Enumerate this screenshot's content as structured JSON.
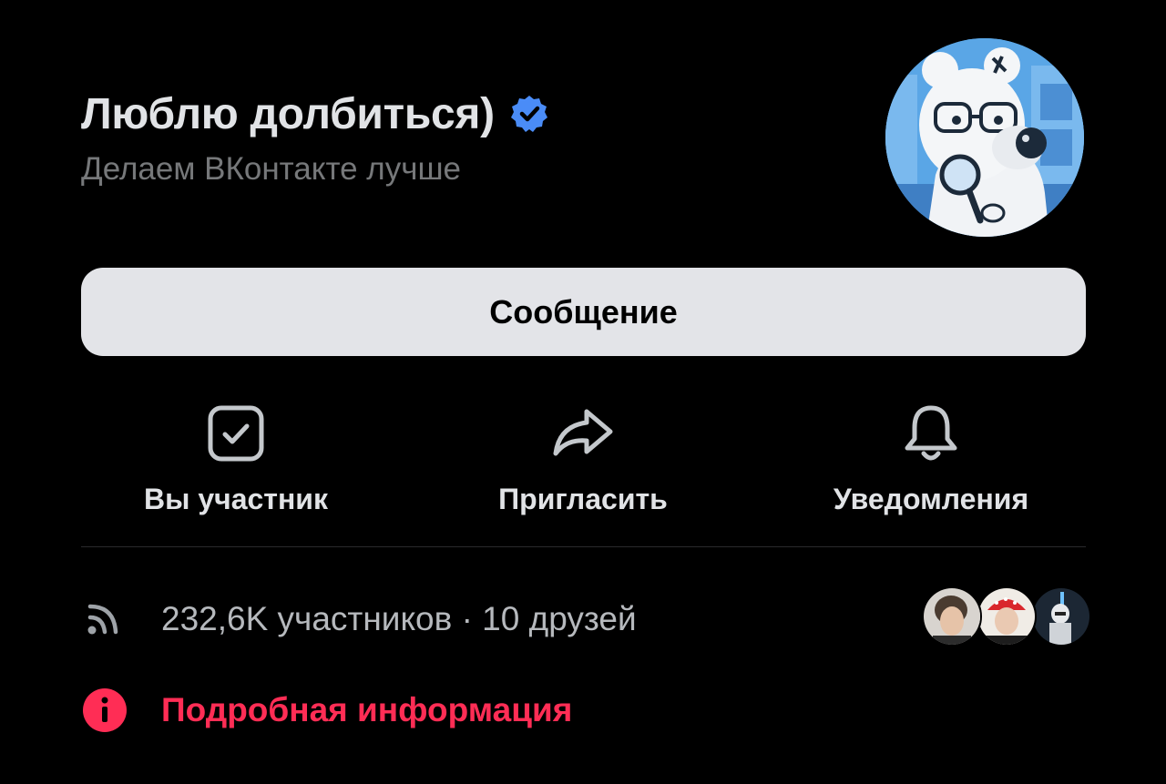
{
  "community": {
    "name": "Люблю долбиться)",
    "status": "Делаем ВКонтакте лучше"
  },
  "primary_action": {
    "label": "Сообщение"
  },
  "actions": [
    {
      "label": "Вы участник",
      "icon": "checkbox-checked-icon"
    },
    {
      "label": "Пригласить",
      "icon": "share-arrow-icon"
    },
    {
      "label": "Уведомления",
      "icon": "bell-icon"
    }
  ],
  "stats": {
    "text": "232,6K участников · 10 друзей",
    "icon": "rss-icon"
  },
  "details": {
    "label": "Подробная информация",
    "icon": "info-icon"
  },
  "colors": {
    "background": "#000000",
    "accent_red": "#ff2d55",
    "verified_blue": "#4a8cf7",
    "button_bg": "#e3e4e8"
  }
}
